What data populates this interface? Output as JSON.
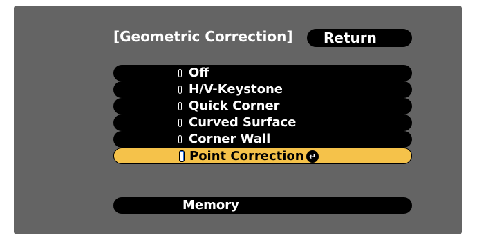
{
  "menu": {
    "title": "[Geometric Correction]",
    "return_label": "Return",
    "options": [
      {
        "label": "Off",
        "selected": false
      },
      {
        "label": "H/V-Keystone",
        "selected": false
      },
      {
        "label": "Quick Corner",
        "selected": false
      },
      {
        "label": "Curved Surface",
        "selected": false
      },
      {
        "label": "Corner Wall",
        "selected": false
      },
      {
        "label": "Point Correction",
        "selected": true
      }
    ],
    "memory_label": "Memory",
    "enter_icon": "enter-icon"
  },
  "colors": {
    "panel": "#646464",
    "item_background": "#000000",
    "selected_background": "#f5c24a",
    "text": "#ffffff"
  }
}
